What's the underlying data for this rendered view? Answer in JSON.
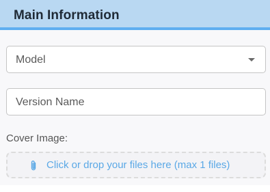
{
  "header": {
    "title": "Main Information"
  },
  "form": {
    "model_select": {
      "placeholder": "Model"
    },
    "version_input": {
      "placeholder": "Version Name"
    },
    "cover_image": {
      "label": "Cover Image:",
      "dropzone_text": "Click or drop your files here (max 1 files)",
      "icon": "paperclip-icon"
    }
  },
  "colors": {
    "header_bg": "#b9d8f2",
    "header_accent": "#5faef0",
    "link_blue": "#5aa8e6"
  }
}
